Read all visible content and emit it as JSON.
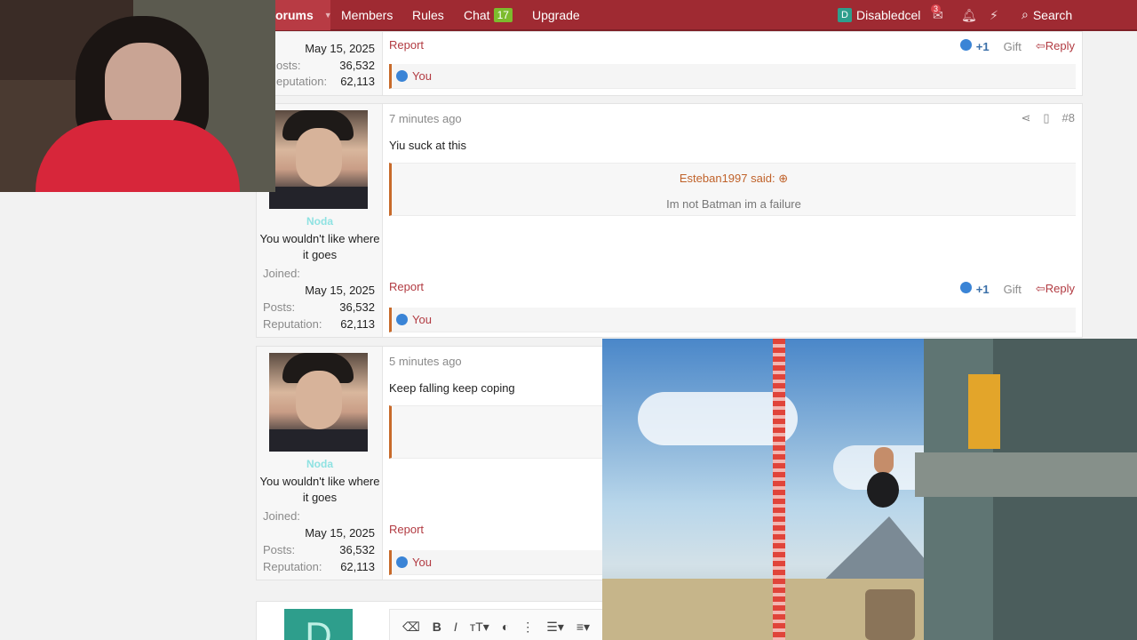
{
  "nav": {
    "forums": "orums",
    "members": "Members",
    "rules": "Rules",
    "chat": "Chat",
    "chat_count": "17",
    "upgrade": "Upgrade",
    "user_initial": "D",
    "username": "Disabledcel",
    "inbox_count": "3",
    "search": "Search"
  },
  "post_top": {
    "joined_date": "May 15, 2025",
    "posts_label": "osts:",
    "posts": "36,532",
    "rep_label": "eputation:",
    "rep": "62,113",
    "report": "Report",
    "plus": "+1",
    "gift": "Gift",
    "reply": "Reply",
    "liker": "You"
  },
  "post8": {
    "time": "7 minutes ago",
    "num": "#8",
    "username": "Noda",
    "user_title": "You wouldn't like where it goes",
    "joined_label": "Joined:",
    "joined_date": "May 15, 2025",
    "posts_label": "Posts:",
    "posts": "36,532",
    "rep_label": "Reputation:",
    "rep": "62,113",
    "text": "Yiu suck at this",
    "quote_author": "Esteban1997 said:",
    "quote_text": "Im not Batman im a failure",
    "report": "Report",
    "plus": "+1",
    "gift": "Gift",
    "reply": "Reply",
    "liker": "You"
  },
  "post9": {
    "time": "5 minutes ago",
    "username": "Noda",
    "user_title": "You wouldn't like where it goes",
    "joined_label": "Joined:",
    "joined_date": "May 15, 2025",
    "posts_label": "Posts:",
    "posts": "36,532",
    "rep_label": "Reputation:",
    "rep": "62,113",
    "text": "Keep falling keep coping",
    "report": "Report",
    "liker": "You"
  },
  "composer": {
    "avatar_initial": "D"
  },
  "colors": {
    "nav": "#9f2a32",
    "accent": "#b23b42",
    "quote_border": "#c86a2a",
    "username": "#8fe2e2"
  }
}
